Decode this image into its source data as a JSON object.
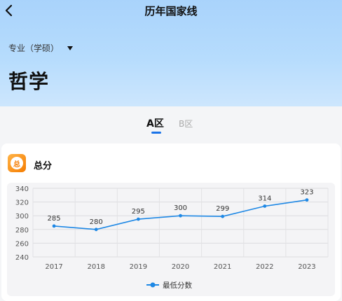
{
  "header": {
    "title": "历年国家线",
    "major_type": "专业（学硕）",
    "subject": "哲学"
  },
  "tabs": [
    {
      "label": "A区",
      "active": true
    },
    {
      "label": "B区",
      "active": false
    }
  ],
  "card": {
    "icon_char": "总",
    "title": "总分"
  },
  "colors": {
    "accent": "#1a73e8",
    "series": "#1e88e5",
    "icon": "#f57c00"
  },
  "chart_data": {
    "type": "line",
    "x": [
      "2017",
      "2018",
      "2019",
      "2020",
      "2021",
      "2022",
      "2023"
    ],
    "series": [
      {
        "name": "最低分数",
        "values": [
          285,
          280,
          295,
          300,
          299,
          314,
          323
        ]
      }
    ],
    "ylim": [
      240,
      340
    ],
    "yticks": [
      "240",
      "260",
      "280",
      "300",
      "320",
      "340"
    ],
    "grid": true,
    "legend": "bottom"
  }
}
